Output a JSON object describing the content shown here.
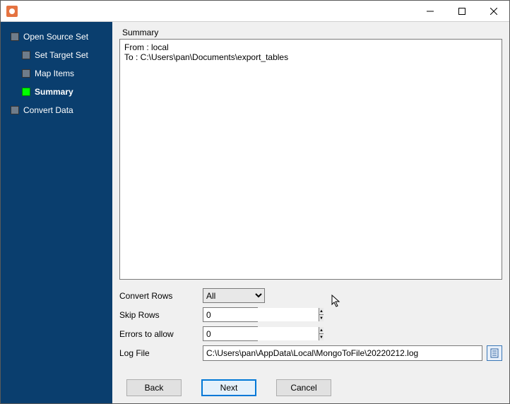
{
  "sidebar": {
    "items": [
      {
        "label": "Open Source Set",
        "indent": 1,
        "active": false
      },
      {
        "label": "Set Target Set",
        "indent": 2,
        "active": false
      },
      {
        "label": "Map Items",
        "indent": 2,
        "active": false
      },
      {
        "label": "Summary",
        "indent": 2,
        "active": true
      },
      {
        "label": "Convert Data",
        "indent": 1,
        "active": false
      }
    ]
  },
  "main": {
    "section_title": "Summary",
    "summary_text": "From : local\nTo : C:\\Users\\pan\\Documents\\export_tables",
    "form": {
      "convert_rows_label": "Convert Rows",
      "convert_rows_value": "All",
      "skip_rows_label": "Skip Rows",
      "skip_rows_value": "0",
      "errors_label": "Errors to allow",
      "errors_value": "0",
      "logfile_label": "Log File",
      "logfile_value": "C:\\Users\\pan\\AppData\\Local\\MongoToFile\\20220212.log"
    },
    "buttons": {
      "back": "Back",
      "next": "Next",
      "cancel": "Cancel"
    }
  }
}
